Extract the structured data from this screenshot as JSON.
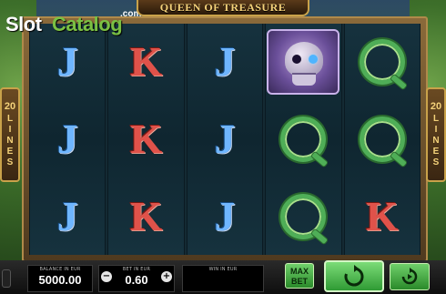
{
  "logo": {
    "slot": "Slot",
    "catalog": "Catalog",
    "com": ".com"
  },
  "game_title": "Queen of Treasure",
  "lines_badge": {
    "number": "20",
    "letters": [
      "L",
      "I",
      "N",
      "E",
      "S"
    ]
  },
  "reels": [
    [
      "J",
      "J",
      "J"
    ],
    [
      "K",
      "K",
      "K"
    ],
    [
      "J",
      "J",
      "J"
    ],
    [
      "skull",
      "Q",
      "Q"
    ],
    [
      "Q",
      "Q",
      "K"
    ]
  ],
  "balance": {
    "label": "BALANCE IN EUR",
    "value": "5000.00"
  },
  "bet": {
    "label": "BET IN EUR",
    "value": "0.60",
    "minus": "−",
    "plus": "+"
  },
  "win": {
    "label": "WIN IN EUR",
    "value": ""
  },
  "max_bet": {
    "line1": "MAX",
    "line2": "BET"
  },
  "icons": {
    "spin": "spin-arrow-icon",
    "autoplay": "autoplay-icon",
    "home": "home-icon"
  },
  "colors": {
    "accent_green": "#4fae57",
    "title_gold": "#f4d27a",
    "frame_gold": "#c9a24a"
  }
}
